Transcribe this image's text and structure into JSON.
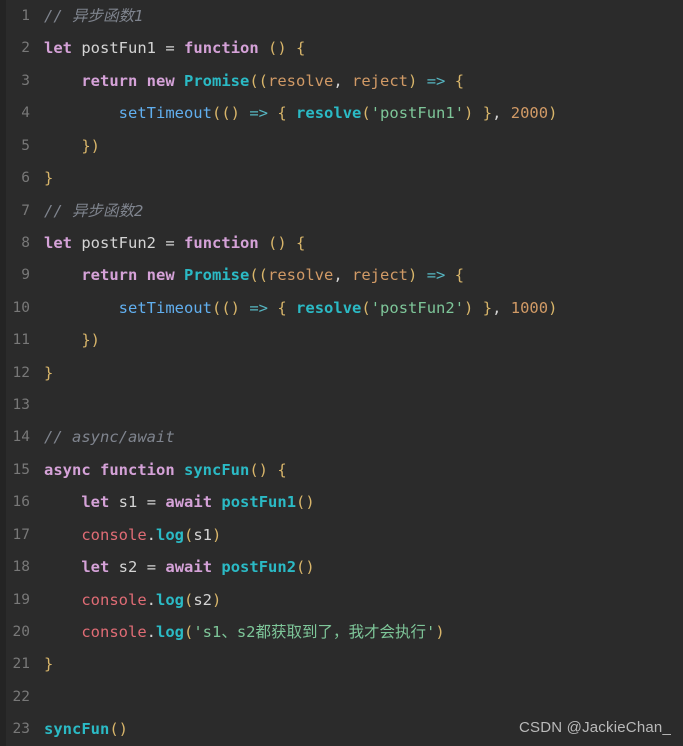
{
  "editor": {
    "language": "javascript",
    "background_color": "#2b2b2b",
    "gutter_color": "#242424",
    "line_count": 23,
    "colors": {
      "comment": "#7f848e",
      "keyword": "#d5a2d8",
      "function": "#2bbac5",
      "string": "#7ec699",
      "number": "#d19a66",
      "parameter": "#d19a66",
      "punctuation": "#d8b56a",
      "plain": "#d4d4d4",
      "object": "#e06c75",
      "line_number": "#787878"
    }
  },
  "watermark": {
    "text": "CSDN @JackieChan_"
  },
  "lines": [
    {
      "number": "1",
      "text": "// 异步函数1",
      "tokens": [
        {
          "t": "// 异步函数1",
          "c": "t-comment"
        }
      ]
    },
    {
      "number": "2",
      "text": "let postFun1 = function () {",
      "tokens": [
        {
          "t": "let",
          "c": "t-keyword"
        },
        {
          "t": " ",
          "c": "t-plain"
        },
        {
          "t": "postFun1",
          "c": "t-var"
        },
        {
          "t": " ",
          "c": "t-plain"
        },
        {
          "t": "=",
          "c": "t-op"
        },
        {
          "t": " ",
          "c": "t-plain"
        },
        {
          "t": "function",
          "c": "t-keyword"
        },
        {
          "t": " ",
          "c": "t-plain"
        },
        {
          "t": "()",
          "c": "t-punc"
        },
        {
          "t": " ",
          "c": "t-plain"
        },
        {
          "t": "{",
          "c": "t-punc"
        }
      ]
    },
    {
      "number": "3",
      "text": "    return new Promise((resolve, reject) => {",
      "tokens": [
        {
          "t": "    ",
          "c": "t-plain"
        },
        {
          "t": "return",
          "c": "t-keyword"
        },
        {
          "t": " ",
          "c": "t-plain"
        },
        {
          "t": "new",
          "c": "t-keyword"
        },
        {
          "t": " ",
          "c": "t-plain"
        },
        {
          "t": "Promise",
          "c": "t-class"
        },
        {
          "t": "((",
          "c": "t-punc"
        },
        {
          "t": "resolve",
          "c": "t-param"
        },
        {
          "t": ", ",
          "c": "t-plain"
        },
        {
          "t": "reject",
          "c": "t-param"
        },
        {
          "t": ")",
          "c": "t-punc"
        },
        {
          "t": " ",
          "c": "t-plain"
        },
        {
          "t": "=>",
          "c": "t-arrow"
        },
        {
          "t": " ",
          "c": "t-plain"
        },
        {
          "t": "{",
          "c": "t-punc"
        }
      ]
    },
    {
      "number": "4",
      "text": "        setTimeout(() => { resolve('postFun1') }, 2000)",
      "tokens": [
        {
          "t": "        ",
          "c": "t-plain"
        },
        {
          "t": "setTimeout",
          "c": "t-method"
        },
        {
          "t": "((",
          "c": "t-punc"
        },
        {
          "t": ")",
          "c": "t-punc"
        },
        {
          "t": " ",
          "c": "t-plain"
        },
        {
          "t": "=>",
          "c": "t-arrow"
        },
        {
          "t": " ",
          "c": "t-plain"
        },
        {
          "t": "{",
          "c": "t-punc"
        },
        {
          "t": " ",
          "c": "t-plain"
        },
        {
          "t": "resolve",
          "c": "t-func"
        },
        {
          "t": "(",
          "c": "t-punc"
        },
        {
          "t": "'postFun1'",
          "c": "t-string"
        },
        {
          "t": ")",
          "c": "t-punc"
        },
        {
          "t": " ",
          "c": "t-plain"
        },
        {
          "t": "}",
          "c": "t-punc"
        },
        {
          "t": ", ",
          "c": "t-plain"
        },
        {
          "t": "2000",
          "c": "t-number"
        },
        {
          "t": ")",
          "c": "t-punc"
        }
      ]
    },
    {
      "number": "5",
      "text": "    })",
      "tokens": [
        {
          "t": "    ",
          "c": "t-plain"
        },
        {
          "t": "})",
          "c": "t-punc"
        }
      ]
    },
    {
      "number": "6",
      "text": "}",
      "tokens": [
        {
          "t": "}",
          "c": "t-punc"
        }
      ]
    },
    {
      "number": "7",
      "text": "// 异步函数2",
      "tokens": [
        {
          "t": "// 异步函数2",
          "c": "t-comment"
        }
      ]
    },
    {
      "number": "8",
      "text": "let postFun2 = function () {",
      "tokens": [
        {
          "t": "let",
          "c": "t-keyword"
        },
        {
          "t": " ",
          "c": "t-plain"
        },
        {
          "t": "postFun2",
          "c": "t-var"
        },
        {
          "t": " ",
          "c": "t-plain"
        },
        {
          "t": "=",
          "c": "t-op"
        },
        {
          "t": " ",
          "c": "t-plain"
        },
        {
          "t": "function",
          "c": "t-keyword"
        },
        {
          "t": " ",
          "c": "t-plain"
        },
        {
          "t": "()",
          "c": "t-punc"
        },
        {
          "t": " ",
          "c": "t-plain"
        },
        {
          "t": "{",
          "c": "t-punc"
        }
      ]
    },
    {
      "number": "9",
      "text": "    return new Promise((resolve, reject) => {",
      "tokens": [
        {
          "t": "    ",
          "c": "t-plain"
        },
        {
          "t": "return",
          "c": "t-keyword"
        },
        {
          "t": " ",
          "c": "t-plain"
        },
        {
          "t": "new",
          "c": "t-keyword"
        },
        {
          "t": " ",
          "c": "t-plain"
        },
        {
          "t": "Promise",
          "c": "t-class"
        },
        {
          "t": "((",
          "c": "t-punc"
        },
        {
          "t": "resolve",
          "c": "t-param"
        },
        {
          "t": ", ",
          "c": "t-plain"
        },
        {
          "t": "reject",
          "c": "t-param"
        },
        {
          "t": ")",
          "c": "t-punc"
        },
        {
          "t": " ",
          "c": "t-plain"
        },
        {
          "t": "=>",
          "c": "t-arrow"
        },
        {
          "t": " ",
          "c": "t-plain"
        },
        {
          "t": "{",
          "c": "t-punc"
        }
      ]
    },
    {
      "number": "10",
      "text": "        setTimeout(() => { resolve('postFun2') }, 1000)",
      "tokens": [
        {
          "t": "        ",
          "c": "t-plain"
        },
        {
          "t": "setTimeout",
          "c": "t-method"
        },
        {
          "t": "((",
          "c": "t-punc"
        },
        {
          "t": ")",
          "c": "t-punc"
        },
        {
          "t": " ",
          "c": "t-plain"
        },
        {
          "t": "=>",
          "c": "t-arrow"
        },
        {
          "t": " ",
          "c": "t-plain"
        },
        {
          "t": "{",
          "c": "t-punc"
        },
        {
          "t": " ",
          "c": "t-plain"
        },
        {
          "t": "resolve",
          "c": "t-func"
        },
        {
          "t": "(",
          "c": "t-punc"
        },
        {
          "t": "'postFun2'",
          "c": "t-string"
        },
        {
          "t": ")",
          "c": "t-punc"
        },
        {
          "t": " ",
          "c": "t-plain"
        },
        {
          "t": "}",
          "c": "t-punc"
        },
        {
          "t": ", ",
          "c": "t-plain"
        },
        {
          "t": "1000",
          "c": "t-number"
        },
        {
          "t": ")",
          "c": "t-punc"
        }
      ]
    },
    {
      "number": "11",
      "text": "    })",
      "tokens": [
        {
          "t": "    ",
          "c": "t-plain"
        },
        {
          "t": "})",
          "c": "t-punc"
        }
      ]
    },
    {
      "number": "12",
      "text": "}",
      "tokens": [
        {
          "t": "}",
          "c": "t-punc"
        }
      ]
    },
    {
      "number": "13",
      "text": "",
      "tokens": []
    },
    {
      "number": "14",
      "text": "// async/await",
      "tokens": [
        {
          "t": "// async/await",
          "c": "t-comment"
        }
      ]
    },
    {
      "number": "15",
      "text": "async function syncFun() {",
      "tokens": [
        {
          "t": "async",
          "c": "t-keyword"
        },
        {
          "t": " ",
          "c": "t-plain"
        },
        {
          "t": "function",
          "c": "t-keyword"
        },
        {
          "t": " ",
          "c": "t-plain"
        },
        {
          "t": "syncFun",
          "c": "t-func"
        },
        {
          "t": "()",
          "c": "t-punc"
        },
        {
          "t": " ",
          "c": "t-plain"
        },
        {
          "t": "{",
          "c": "t-punc"
        }
      ]
    },
    {
      "number": "16",
      "text": "    let s1 = await postFun1()",
      "tokens": [
        {
          "t": "    ",
          "c": "t-plain"
        },
        {
          "t": "let",
          "c": "t-keyword"
        },
        {
          "t": " ",
          "c": "t-plain"
        },
        {
          "t": "s1",
          "c": "t-var"
        },
        {
          "t": " ",
          "c": "t-plain"
        },
        {
          "t": "=",
          "c": "t-op"
        },
        {
          "t": " ",
          "c": "t-plain"
        },
        {
          "t": "await",
          "c": "t-keyword"
        },
        {
          "t": " ",
          "c": "t-plain"
        },
        {
          "t": "postFun1",
          "c": "t-func"
        },
        {
          "t": "()",
          "c": "t-punc"
        }
      ]
    },
    {
      "number": "17",
      "text": "    console.log(s1)",
      "tokens": [
        {
          "t": "    ",
          "c": "t-plain"
        },
        {
          "t": "console",
          "c": "t-object"
        },
        {
          "t": ".",
          "c": "t-plain"
        },
        {
          "t": "log",
          "c": "t-func"
        },
        {
          "t": "(",
          "c": "t-punc"
        },
        {
          "t": "s1",
          "c": "t-var"
        },
        {
          "t": ")",
          "c": "t-punc"
        }
      ]
    },
    {
      "number": "18",
      "text": "    let s2 = await postFun2()",
      "tokens": [
        {
          "t": "    ",
          "c": "t-plain"
        },
        {
          "t": "let",
          "c": "t-keyword"
        },
        {
          "t": " ",
          "c": "t-plain"
        },
        {
          "t": "s2",
          "c": "t-var"
        },
        {
          "t": " ",
          "c": "t-plain"
        },
        {
          "t": "=",
          "c": "t-op"
        },
        {
          "t": " ",
          "c": "t-plain"
        },
        {
          "t": "await",
          "c": "t-keyword"
        },
        {
          "t": " ",
          "c": "t-plain"
        },
        {
          "t": "postFun2",
          "c": "t-func"
        },
        {
          "t": "()",
          "c": "t-punc"
        }
      ]
    },
    {
      "number": "19",
      "text": "    console.log(s2)",
      "tokens": [
        {
          "t": "    ",
          "c": "t-plain"
        },
        {
          "t": "console",
          "c": "t-object"
        },
        {
          "t": ".",
          "c": "t-plain"
        },
        {
          "t": "log",
          "c": "t-func"
        },
        {
          "t": "(",
          "c": "t-punc"
        },
        {
          "t": "s2",
          "c": "t-var"
        },
        {
          "t": ")",
          "c": "t-punc"
        }
      ]
    },
    {
      "number": "20",
      "text": "    console.log('s1、s2都获取到了，我才会执行')",
      "tokens": [
        {
          "t": "    ",
          "c": "t-plain"
        },
        {
          "t": "console",
          "c": "t-object"
        },
        {
          "t": ".",
          "c": "t-plain"
        },
        {
          "t": "log",
          "c": "t-func"
        },
        {
          "t": "(",
          "c": "t-punc"
        },
        {
          "t": "'s1、s2都获取到了，我才会执行'",
          "c": "t-string"
        },
        {
          "t": ")",
          "c": "t-punc"
        }
      ]
    },
    {
      "number": "21",
      "text": "}",
      "tokens": [
        {
          "t": "}",
          "c": "t-punc"
        }
      ]
    },
    {
      "number": "22",
      "text": "",
      "tokens": []
    },
    {
      "number": "23",
      "text": "syncFun()",
      "tokens": [
        {
          "t": "syncFun",
          "c": "t-func"
        },
        {
          "t": "()",
          "c": "t-punc"
        }
      ]
    }
  ]
}
